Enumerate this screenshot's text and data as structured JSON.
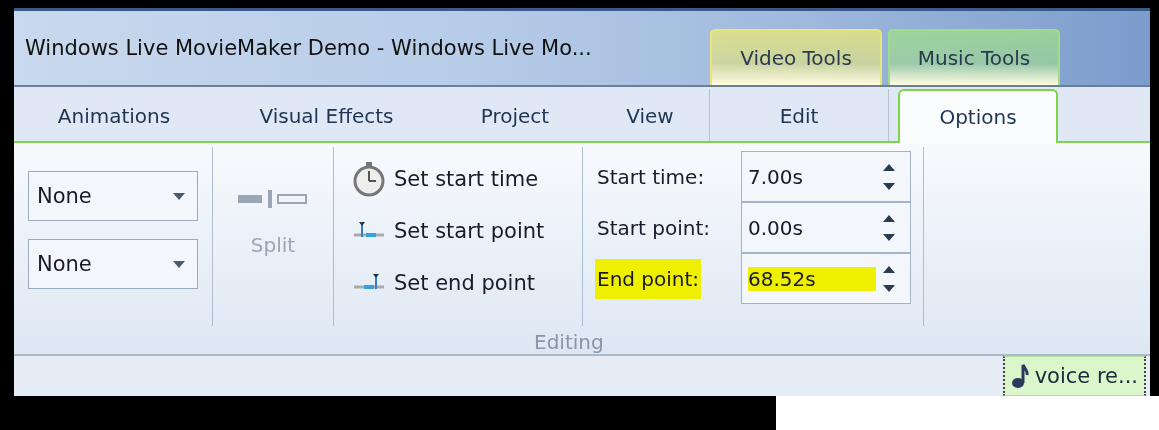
{
  "window": {
    "title": "Windows Live MovieMaker Demo - Windows Live Mo..."
  },
  "context_groups": [
    {
      "label": "Video Tools",
      "color": "#e6e67a",
      "tabs": [
        {
          "label": "Edit",
          "selected": false
        }
      ]
    },
    {
      "label": "Music Tools",
      "color": "#9fdc8c",
      "tabs": [
        {
          "label": "Options",
          "selected": true
        }
      ]
    }
  ],
  "tabs": [
    {
      "label": "Animations",
      "selected": false
    },
    {
      "label": "Visual Effects",
      "selected": false
    },
    {
      "label": "Project",
      "selected": false
    },
    {
      "label": "View",
      "selected": false
    }
  ],
  "ribbon": {
    "dropdowns": [
      {
        "value": "None"
      },
      {
        "value": "None"
      }
    ],
    "split_button": {
      "label": "Split",
      "disabled": true
    },
    "commands": [
      {
        "label": "Set start time",
        "kind": "clock"
      },
      {
        "label": "Set start point",
        "kind": "start"
      },
      {
        "label": "Set end point",
        "kind": "end"
      }
    ],
    "fields": [
      {
        "label": "Start time:",
        "value": "7.00s",
        "highlighted": false
      },
      {
        "label": "Start point:",
        "value": "0.00s",
        "highlighted": false
      },
      {
        "label": "End point:",
        "value": "68.52s",
        "highlighted": true
      }
    ],
    "group_label": "Editing"
  },
  "timeline": {
    "clip": {
      "label": "voice re..."
    }
  }
}
